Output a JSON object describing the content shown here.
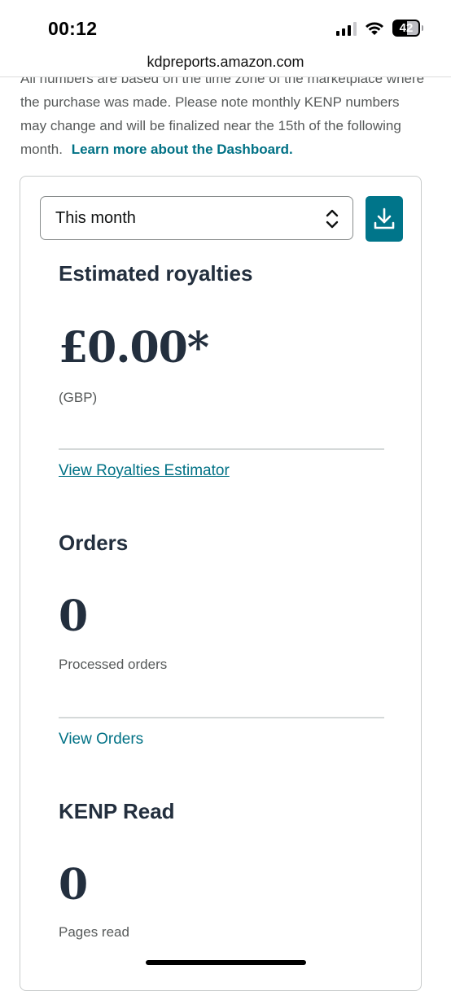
{
  "status_bar": {
    "time": "00:12",
    "battery": "42",
    "icons": [
      "cellular-signal-icon",
      "wifi-icon",
      "battery-icon"
    ]
  },
  "browser": {
    "url": "kdpreports.amazon.com"
  },
  "intro": {
    "text": "All numbers are based on the time zone of the marketplace where the purchase was made. Please note monthly KENP numbers may change and will be finalized near the 15th of the following month.",
    "link": "Learn more about the Dashboard."
  },
  "filter": {
    "selected": "This month"
  },
  "royalties": {
    "title": "Estimated royalties",
    "amount": "£0.00*",
    "currency": "(GBP)",
    "link": "View Royalties Estimator"
  },
  "orders": {
    "title": "Orders",
    "count": "0",
    "label": "Processed orders",
    "link": "View Orders"
  },
  "kenp": {
    "title": "KENP Read",
    "count": "0",
    "label": "Pages read"
  },
  "colors": {
    "accent": "#007185",
    "button": "#00758a",
    "heading": "#232f3e",
    "muted": "#565959"
  }
}
